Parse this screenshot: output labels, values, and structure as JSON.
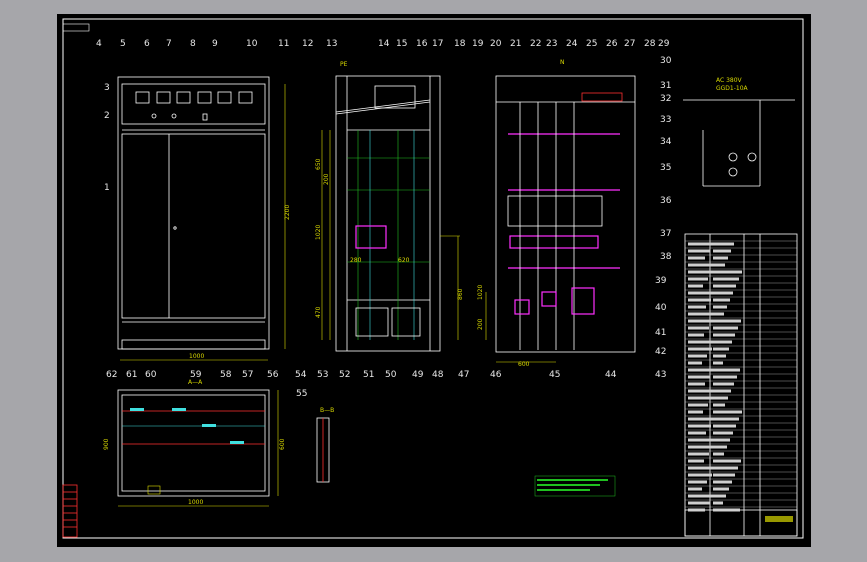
{
  "drawing": {
    "label_numbers_top": [
      "4",
      "5",
      "6",
      "7",
      "8",
      "9",
      "10",
      "11",
      "12",
      "13",
      "14",
      "15",
      "16",
      "17",
      "18",
      "19",
      "20",
      "21",
      "22",
      "23",
      "24",
      "25",
      "26",
      "27",
      "28",
      "29",
      "30",
      "31",
      "32",
      "33",
      "34",
      "35",
      "36",
      "37",
      "38"
    ],
    "label_numbers_bottom": [
      "54",
      "53",
      "52",
      "51",
      "50",
      "49",
      "48",
      "47",
      "46",
      "45",
      "44",
      "43",
      "42",
      "41",
      "40",
      "39"
    ],
    "label_numbers_plan": [
      "62",
      "61",
      "60",
      "59",
      "58",
      "57",
      "56",
      "55"
    ],
    "label_numbers_left": [
      "1",
      "2",
      "3"
    ],
    "colors": {
      "background": "#000000",
      "frame": "#ffffff",
      "dimension": "#d9d900",
      "wire_magenta": "#ff30ff",
      "wire_red": "#ff3030",
      "wire_green": "#20c020",
      "wire_cyan": "#40e0e0",
      "outer": "#a6a6aa"
    }
  }
}
